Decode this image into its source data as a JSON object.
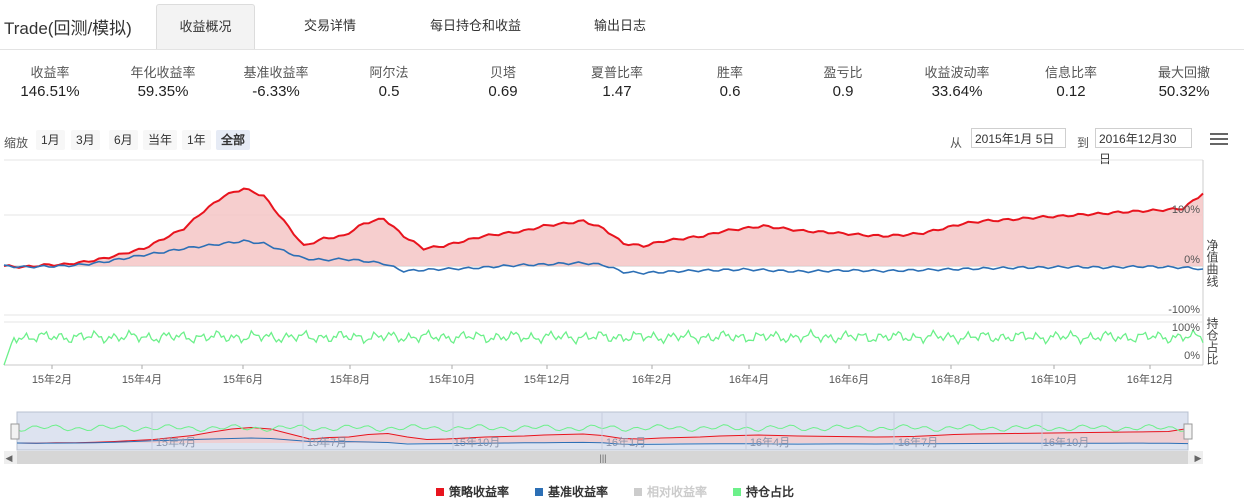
{
  "app": {
    "title": "Trade(回测/模拟)"
  },
  "tabs": [
    {
      "label": "收益概况",
      "active": true
    },
    {
      "label": "交易详情",
      "active": false
    },
    {
      "label": "每日持仓和收益",
      "active": false
    },
    {
      "label": "输出日志",
      "active": false
    }
  ],
  "metrics": [
    {
      "label": "收益率",
      "value": "146.51%"
    },
    {
      "label": "年化收益率",
      "value": "59.35%"
    },
    {
      "label": "基准收益率",
      "value": "-6.33%"
    },
    {
      "label": "阿尔法",
      "value": "0.5"
    },
    {
      "label": "贝塔",
      "value": "0.69"
    },
    {
      "label": "夏普比率",
      "value": "1.47"
    },
    {
      "label": "胜率",
      "value": "0.6"
    },
    {
      "label": "盈亏比",
      "value": "0.9"
    },
    {
      "label": "收益波动率",
      "value": "33.64%"
    },
    {
      "label": "信息比率",
      "value": "0.12"
    },
    {
      "label": "最大回撤",
      "value": "50.32%"
    }
  ],
  "zoom": {
    "label": "缩放",
    "buttons": [
      "1月",
      "3月",
      "6月",
      "当年",
      "1年",
      "全部"
    ],
    "active": "全部",
    "from_label": "从",
    "from_value": "2015年1月 5日",
    "to_label": "到",
    "to_value": "2016年12月30日"
  },
  "icons": {
    "menu": "hamburger-menu-icon"
  },
  "colors": {
    "strategy": "#e8141e",
    "strategy_fill": "#f5c6c6",
    "benchmark": "#2c6fb5",
    "relative": "#cccccc",
    "position": "#6cf08a"
  },
  "chart_data": {
    "type": "line",
    "x_ticks": [
      "15年2月",
      "15年4月",
      "15年6月",
      "15年8月",
      "15年10月",
      "15年12月",
      "16年2月",
      "16年4月",
      "16年6月",
      "16年8月",
      "16年10月",
      "16年12月"
    ],
    "navigator_ticks": [
      "15年4月",
      "15年7月",
      "15年10月",
      "16年1月",
      "16年4月",
      "16年7月",
      "16年10月"
    ],
    "upper_panel": {
      "axis_label": "净值曲线",
      "y_ticks": [
        "100%",
        "0%",
        "-100%"
      ],
      "ylim": [
        -100,
        100
      ],
      "series": [
        {
          "name": "策略收益率",
          "color": "#e8141e",
          "area": true,
          "points": [
            [
              0,
              0
            ],
            [
              4,
              -2
            ],
            [
              8,
              2
            ],
            [
              12,
              3
            ],
            [
              16,
              8
            ],
            [
              20,
              15
            ],
            [
              24,
              25
            ],
            [
              28,
              35
            ],
            [
              32,
              55
            ],
            [
              36,
              75
            ],
            [
              40,
              110
            ],
            [
              44,
              140
            ],
            [
              48,
              155
            ],
            [
              52,
              140
            ],
            [
              56,
              90
            ],
            [
              60,
              40
            ],
            [
              64,
              55
            ],
            [
              68,
              60
            ],
            [
              72,
              85
            ],
            [
              76,
              95
            ],
            [
              80,
              60
            ],
            [
              84,
              35
            ],
            [
              88,
              40
            ],
            [
              92,
              50
            ],
            [
              96,
              60
            ],
            [
              100,
              65
            ],
            [
              104,
              70
            ],
            [
              108,
              80
            ],
            [
              112,
              85
            ],
            [
              116,
              90
            ],
            [
              120,
              75
            ],
            [
              124,
              45
            ],
            [
              128,
              40
            ],
            [
              132,
              50
            ],
            [
              136,
              55
            ],
            [
              140,
              60
            ],
            [
              144,
              70
            ],
            [
              148,
              75
            ],
            [
              152,
              80
            ],
            [
              156,
              75
            ],
            [
              160,
              70
            ],
            [
              164,
              68
            ],
            [
              168,
              65
            ],
            [
              172,
              62
            ],
            [
              176,
              60
            ],
            [
              180,
              62
            ],
            [
              184,
              66
            ],
            [
              188,
              75
            ],
            [
              192,
              85
            ],
            [
              196,
              90
            ],
            [
              200,
              92
            ],
            [
              204,
              95
            ],
            [
              208,
              98
            ],
            [
              212,
              100
            ],
            [
              216,
              103
            ],
            [
              220,
              105
            ],
            [
              224,
              108
            ],
            [
              228,
              110
            ],
            [
              232,
              112
            ],
            [
              236,
              115
            ],
            [
              240,
              145
            ]
          ]
        },
        {
          "name": "基准收益率",
          "color": "#2c6fb5",
          "area": false,
          "points": [
            [
              0,
              0
            ],
            [
              4,
              -2
            ],
            [
              8,
              -1
            ],
            [
              12,
              0
            ],
            [
              16,
              3
            ],
            [
              20,
              8
            ],
            [
              24,
              15
            ],
            [
              28,
              22
            ],
            [
              32,
              28
            ],
            [
              36,
              35
            ],
            [
              40,
              40
            ],
            [
              44,
              45
            ],
            [
              48,
              50
            ],
            [
              52,
              45
            ],
            [
              56,
              30
            ],
            [
              60,
              15
            ],
            [
              64,
              12
            ],
            [
              68,
              14
            ],
            [
              72,
              10
            ],
            [
              76,
              5
            ],
            [
              80,
              -10
            ],
            [
              84,
              -8
            ],
            [
              88,
              -6
            ],
            [
              92,
              -5
            ],
            [
              96,
              -3
            ],
            [
              100,
              0
            ],
            [
              104,
              2
            ],
            [
              108,
              3
            ],
            [
              112,
              5
            ],
            [
              116,
              6
            ],
            [
              120,
              2
            ],
            [
              124,
              -12
            ],
            [
              128,
              -14
            ],
            [
              132,
              -12
            ],
            [
              136,
              -10
            ],
            [
              140,
              -9
            ],
            [
              144,
              -8
            ],
            [
              148,
              -7
            ],
            [
              152,
              -8
            ],
            [
              156,
              -10
            ],
            [
              160,
              -11
            ],
            [
              164,
              -10
            ],
            [
              168,
              -9
            ],
            [
              172,
              -9
            ],
            [
              176,
              -10
            ],
            [
              180,
              -9
            ],
            [
              184,
              -8
            ],
            [
              188,
              -7
            ],
            [
              192,
              -6
            ],
            [
              196,
              -5
            ],
            [
              200,
              -4
            ],
            [
              204,
              -3
            ],
            [
              208,
              -3
            ],
            [
              212,
              -2
            ],
            [
              216,
              -2
            ],
            [
              220,
              -3
            ],
            [
              224,
              -2
            ],
            [
              228,
              -1
            ],
            [
              232,
              -2
            ],
            [
              236,
              -3
            ],
            [
              240,
              -6
            ]
          ]
        }
      ]
    },
    "lower_panel": {
      "axis_label": "持仓占比",
      "y_ticks": [
        "100%",
        "0%"
      ],
      "ylim": [
        0,
        100
      ],
      "series": [
        {
          "name": "持仓占比",
          "color": "#6cf08a",
          "points_generated": "oscillating 55-85 with drop to 0 at start"
        }
      ]
    },
    "legend": [
      {
        "name": "策略收益率",
        "color": "#e8141e",
        "enabled": true
      },
      {
        "name": "基准收益率",
        "color": "#2c6fb5",
        "enabled": true
      },
      {
        "name": "相对收益率",
        "color": "#cccccc",
        "enabled": false
      },
      {
        "name": "持仓占比",
        "color": "#6cf08a",
        "enabled": true
      }
    ]
  }
}
